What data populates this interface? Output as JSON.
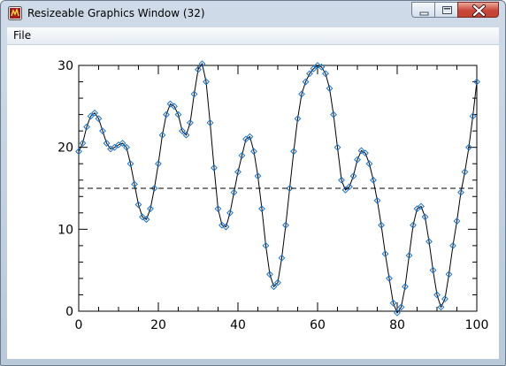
{
  "window": {
    "title": "Resizeable Graphics Window (32)"
  },
  "menu": {
    "file_label": "File"
  },
  "icons": {
    "app": "idl-app-icon",
    "minimize": "minimize-icon",
    "maximize": "maximize-icon",
    "close": "close-icon"
  },
  "chart_data": {
    "type": "line",
    "title": "",
    "xlabel": "",
    "ylabel": "",
    "xlim": [
      0,
      100
    ],
    "ylim": [
      0,
      30
    ],
    "x_ticks": [
      "0",
      "20",
      "40",
      "60",
      "80",
      "100"
    ],
    "y_ticks": [
      "0",
      "10",
      "20",
      "30"
    ],
    "grid": false,
    "series": [
      {
        "marker": "diamond",
        "line_color": "#000000",
        "marker_color": "#1e73c8",
        "x": [
          0,
          1,
          2,
          3,
          4,
          5,
          6,
          7,
          8,
          9,
          10,
          11,
          12,
          13,
          14,
          15,
          16,
          17,
          18,
          19,
          20,
          21,
          22,
          23,
          24,
          25,
          26,
          27,
          28,
          29,
          30,
          31,
          32,
          33,
          34,
          35,
          36,
          37,
          38,
          39,
          40,
          41,
          42,
          43,
          44,
          45,
          46,
          47,
          48,
          49,
          50,
          51,
          52,
          53,
          54,
          55,
          56,
          57,
          58,
          59,
          60,
          61,
          62,
          63,
          64,
          65,
          66,
          67,
          68,
          69,
          70,
          71,
          72,
          73,
          74,
          75,
          76,
          77,
          78,
          79,
          80,
          81,
          82,
          83,
          84,
          85,
          86,
          87,
          88,
          89,
          90,
          91,
          92,
          93,
          94,
          95,
          96,
          97,
          98,
          99,
          100
        ],
        "y": [
          19.5,
          20.5,
          22.5,
          23.8,
          24.2,
          23.5,
          22,
          20.5,
          19.8,
          20,
          20.3,
          20.5,
          20,
          18,
          15.5,
          13,
          11.5,
          11.2,
          12.5,
          15,
          18,
          21.5,
          24,
          25.3,
          25,
          24,
          22,
          21.5,
          23,
          26.5,
          29.5,
          30.2,
          28,
          23,
          17.5,
          12.5,
          10.5,
          10.3,
          12,
          14.5,
          17,
          19,
          21,
          21.3,
          19.5,
          16.5,
          12.5,
          8,
          4.5,
          3,
          3.5,
          6.5,
          10.5,
          15,
          19.5,
          23.5,
          26.5,
          28,
          29,
          29.6,
          30,
          29.8,
          29,
          27.2,
          24,
          20,
          16,
          14.8,
          15.2,
          16.5,
          18.5,
          19.6,
          19.3,
          18,
          16,
          13.5,
          10.5,
          7,
          4,
          1,
          -0.2,
          0.5,
          3,
          6.8,
          10.5,
          12.5,
          12.8,
          11.5,
          8.5,
          5,
          2,
          0.5,
          1.5,
          4.5,
          8,
          11,
          14.5,
          17,
          20,
          23.8,
          28
        ]
      },
      {
        "name": "",
        "style": "dashed",
        "line_color": "#000000",
        "x": [
          0,
          100
        ],
        "y": [
          15,
          15
        ]
      }
    ]
  }
}
